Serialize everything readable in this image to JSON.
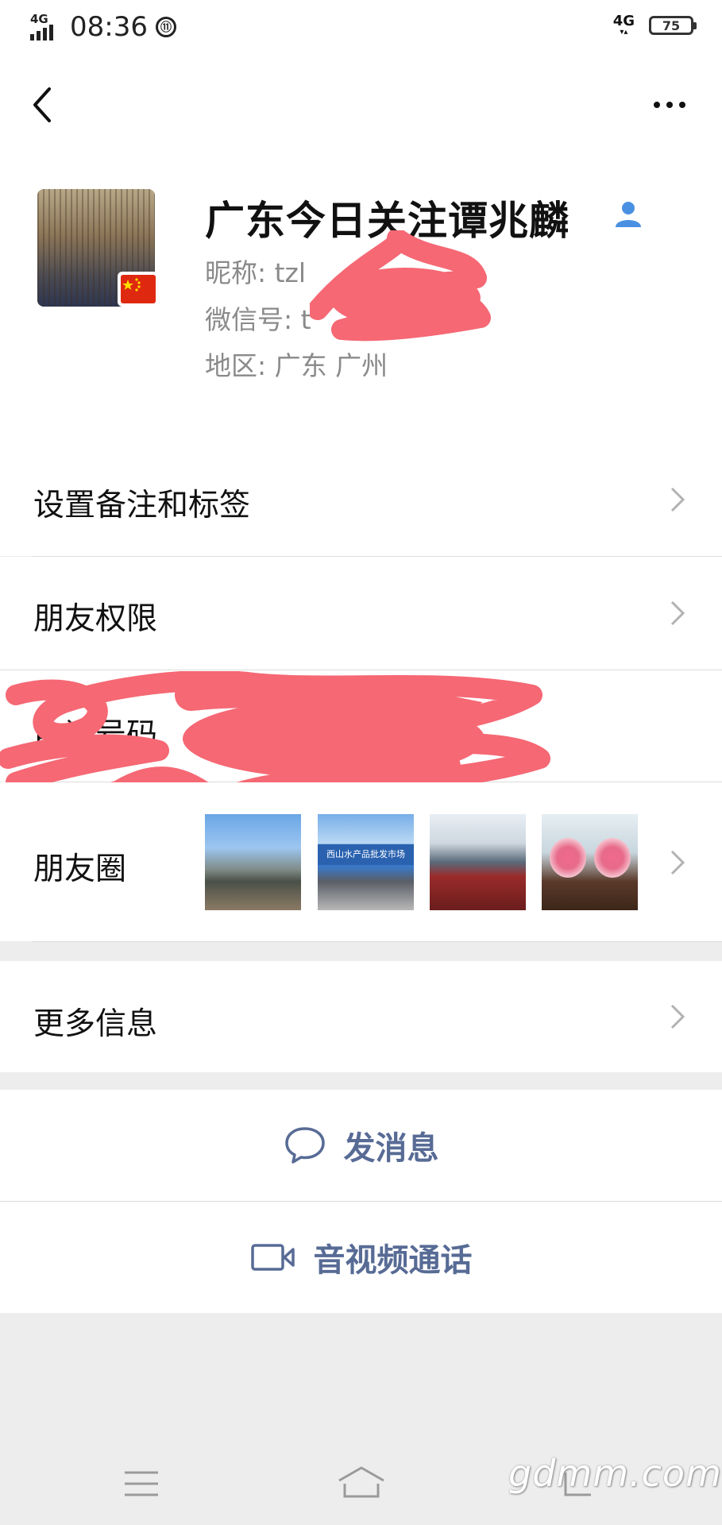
{
  "status_bar": {
    "network": "4G",
    "time": "08:36",
    "circle_icon_text": "⑪",
    "right_network": "4G",
    "battery": "75"
  },
  "profile": {
    "name": "广东今日关注谭兆麟",
    "nickname": "昵称:  tzl",
    "wechat_id": "微信号:  t",
    "region": "地区:  广东  广州"
  },
  "menu": {
    "remark": "设置备注和标签",
    "permission": "朋友权限",
    "phone": "电话号码",
    "moments": "朋友圈",
    "more_info": "更多信息"
  },
  "moments_thumbs": [
    {
      "caption": ""
    },
    {
      "caption": "西山水产品批发市场"
    },
    {
      "caption": ""
    },
    {
      "caption": ""
    }
  ],
  "actions": {
    "send_message": "发消息",
    "video_call": "音视频通话"
  },
  "watermark": "gdmm.com",
  "colors": {
    "link_blue": "#576b95",
    "scribble": "#f56874",
    "page_bg": "#ededed"
  }
}
